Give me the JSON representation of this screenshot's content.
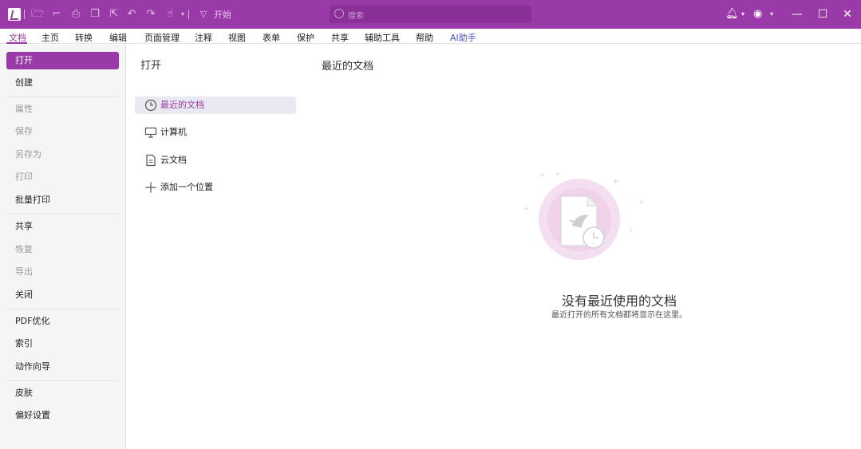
{
  "colors": {
    "brand": "#9a3aa8",
    "selected_bg": "#e9e9f1",
    "ai": "#4a55c8"
  },
  "titlebar": {
    "start_label": "开始",
    "search_placeholder": "搜索",
    "quick_access_icons": [
      "open-folder-icon",
      "new-file-icon",
      "print-icon",
      "copy-icon",
      "export-icon",
      "undo-icon",
      "redo-icon",
      "hand-tool-icon",
      "dropdown-icon"
    ]
  },
  "menu": {
    "tabs": [
      "文档",
      "主页",
      "转换",
      "编辑",
      "页面管理",
      "注释",
      "视图",
      "表单",
      "保护",
      "共享",
      "辅助工具",
      "帮助",
      "AI助手"
    ]
  },
  "leftnav": {
    "items": [
      "打开",
      "创建",
      "属性",
      "保存",
      "另存为",
      "打印",
      "批量打印",
      "共享",
      "恢复",
      "导出",
      "关闭",
      "PDF优化",
      "索引",
      "动作向导",
      "皮肤",
      "偏好设置"
    ]
  },
  "open_panel": {
    "title": "打开",
    "places": [
      "最近的文档",
      "计算机",
      "云文档",
      "添加一个位置"
    ]
  },
  "recent": {
    "title": "最近的文档",
    "empty_title": "没有最近使用的文档",
    "empty_subtitle": "最近打开的所有文档都将显示在这里。"
  }
}
